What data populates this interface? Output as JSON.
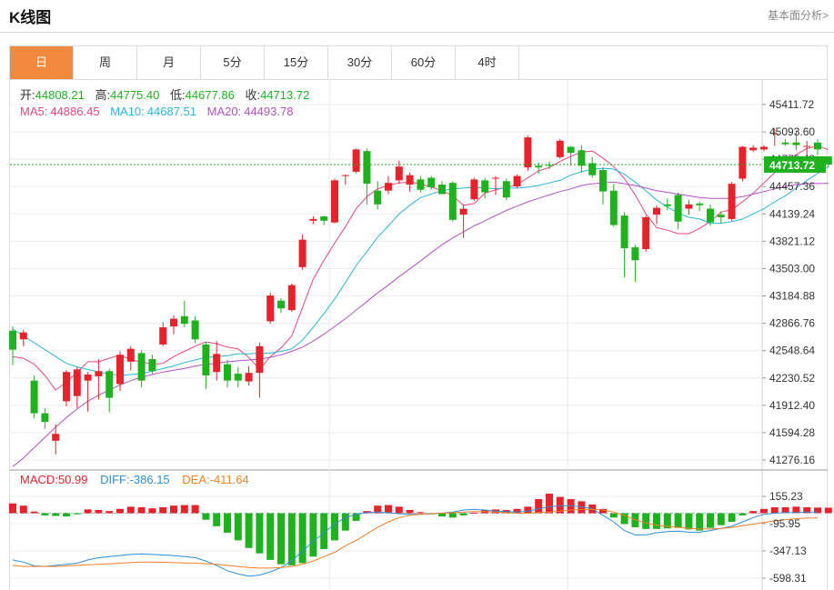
{
  "page": {
    "title": "K线图",
    "more_link": "基本面分析>"
  },
  "tabs": [
    {
      "label": "日",
      "active": true
    },
    {
      "label": "周",
      "active": false
    },
    {
      "label": "月",
      "active": false
    },
    {
      "label": "5分",
      "active": false
    },
    {
      "label": "15分",
      "active": false
    },
    {
      "label": "30分",
      "active": false
    },
    {
      "label": "60分",
      "active": false
    },
    {
      "label": "4时",
      "active": false
    }
  ],
  "ohlc_info": [
    {
      "label": "开:",
      "value": "44808.21"
    },
    {
      "label": "高:",
      "value": "44775.40"
    },
    {
      "label": "低:",
      "value": "44677.86"
    },
    {
      "label": "收:",
      "value": "44713.72"
    }
  ],
  "ma_info": [
    {
      "label": "MA5:",
      "value": "44886.45",
      "color": "#e8467c"
    },
    {
      "label": "MA10:",
      "value": "44687.51",
      "color": "#2bb5d8"
    },
    {
      "label": "MA20:",
      "value": "44493.78",
      "color": "#b450c4"
    }
  ],
  "macd_info": [
    {
      "label": "MACD:",
      "value": "50.99",
      "color": "#e8222a"
    },
    {
      "label": "DIFF:",
      "value": "-386.15",
      "color": "#2d8fd5"
    },
    {
      "label": "DEA:",
      "value": "-411.64",
      "color": "#f07f25"
    }
  ],
  "colors": {
    "up": "#e8222a",
    "down": "#1fb21f",
    "info_value": "#1fb21f",
    "last_price_bg": "#1fb21f",
    "tab_active": "#f28a3d"
  },
  "chart_data": {
    "type": "candlestick",
    "last_price": "44713.72",
    "price_axis_labels": [
      "45411.72",
      "45093.60",
      "44775.48",
      "44457.36",
      "44139.24",
      "43821.12",
      "43503.00",
      "43184.88",
      "42866.76",
      "42548.64",
      "42230.52",
      "41912.40",
      "41594.28",
      "41276.16"
    ],
    "price_ylim": [
      41276.16,
      45411.72
    ],
    "macd_axis_labels": [
      "155.23",
      "-95.95",
      "-347.13",
      "-598.31"
    ],
    "macd_ylim": [
      -598.31,
      155.23
    ],
    "candles": [
      [
        42780,
        42560,
        42830,
        42380
      ],
      [
        42680,
        42760,
        42790,
        42600
      ],
      [
        42200,
        41820,
        42260,
        41760
      ],
      [
        41820,
        41720,
        41880,
        41640
      ],
      [
        41500,
        41580,
        41690,
        41340
      ],
      [
        41960,
        42300,
        42320,
        41900
      ],
      [
        42020,
        42330,
        42360,
        41880
      ],
      [
        42200,
        42270,
        42300,
        41840
      ],
      [
        42250,
        42310,
        42450,
        41980
      ],
      [
        42310,
        42000,
        42340,
        41830
      ],
      [
        42160,
        42500,
        42540,
        42080
      ],
      [
        42420,
        42570,
        42600,
        42320
      ],
      [
        42520,
        42200,
        42550,
        42120
      ],
      [
        42450,
        42310,
        42500,
        42280
      ],
      [
        42620,
        42820,
        42880,
        42600
      ],
      [
        42830,
        42920,
        42960,
        42740
      ],
      [
        42950,
        42860,
        43130,
        42820
      ],
      [
        42900,
        42680,
        42950,
        42640
      ],
      [
        42620,
        42260,
        42650,
        42100
      ],
      [
        42300,
        42510,
        42660,
        42200
      ],
      [
        42390,
        42200,
        42440,
        42120
      ],
      [
        42280,
        42200,
        42360,
        42120
      ],
      [
        42190,
        42290,
        42370,
        42140
      ],
      [
        42290,
        42600,
        42640,
        42000
      ],
      [
        42890,
        43190,
        43220,
        42860
      ],
      [
        43130,
        43040,
        43160,
        42990
      ],
      [
        43020,
        43310,
        43330,
        43000
      ],
      [
        43520,
        43840,
        43900,
        43490
      ],
      [
        44060,
        44080,
        44110,
        44020
      ],
      [
        44110,
        44060,
        44120,
        44010
      ],
      [
        44040,
        44530,
        44550,
        44030
      ],
      [
        44580,
        44590,
        44600,
        44480
      ],
      [
        44630,
        44890,
        44900,
        44610
      ],
      [
        44870,
        44490,
        44900,
        44250
      ],
      [
        44410,
        44250,
        44520,
        44190
      ],
      [
        44410,
        44500,
        44580,
        44370
      ],
      [
        44530,
        44690,
        44760,
        44490
      ],
      [
        44480,
        44590,
        44620,
        44400
      ],
      [
        44540,
        44420,
        44580,
        44390
      ],
      [
        44560,
        44450,
        44580,
        44420
      ],
      [
        44480,
        44370,
        44520,
        44380
      ],
      [
        44500,
        44070,
        44520,
        44050
      ],
      [
        44130,
        44200,
        44250,
        43860
      ],
      [
        44310,
        44540,
        44560,
        44290
      ],
      [
        44530,
        44390,
        44560,
        44320
      ],
      [
        44560,
        44560,
        44580,
        44360
      ],
      [
        44520,
        44330,
        44550,
        44300
      ],
      [
        44460,
        44580,
        44600,
        44440
      ],
      [
        44680,
        45030,
        45050,
        44640
      ],
      [
        44700,
        44680,
        44740,
        44610
      ],
      [
        44710,
        44700,
        44750,
        44660
      ],
      [
        44800,
        44990,
        45010,
        44780
      ],
      [
        44920,
        44850,
        44930,
        44700
      ],
      [
        44880,
        44700,
        44940,
        44620
      ],
      [
        44730,
        44590,
        44800,
        44560
      ],
      [
        44650,
        44400,
        44680,
        44250
      ],
      [
        44410,
        44010,
        44490,
        43990
      ],
      [
        44120,
        43740,
        44160,
        43400
      ],
      [
        43750,
        43600,
        43780,
        43350
      ],
      [
        43730,
        44100,
        44120,
        43700
      ],
      [
        44130,
        44210,
        44240,
        44020
      ],
      [
        44250,
        44230,
        44320,
        44180
      ],
      [
        44360,
        44050,
        44390,
        43960
      ],
      [
        44200,
        44250,
        44300,
        44130
      ],
      [
        44260,
        44240,
        44280,
        44170
      ],
      [
        44200,
        44040,
        44250,
        44000
      ],
      [
        44130,
        44100,
        44170,
        44030
      ],
      [
        44080,
        44490,
        44510,
        44060
      ],
      [
        44550,
        44920,
        44930,
        44520
      ],
      [
        44880,
        44910,
        44940,
        44860
      ],
      [
        44890,
        44920,
        44940,
        44870
      ],
      [
        45070,
        45080,
        45130,
        44930
      ],
      [
        44970,
        44950,
        45010,
        44930
      ],
      [
        44970,
        44940,
        45110,
        44880
      ],
      [
        44920,
        44930,
        44990,
        44770
      ],
      [
        44970,
        44890,
        45010,
        44820
      ],
      [
        44808.21,
        44713.72,
        44775.4,
        44677.86
      ]
    ],
    "ma5": [
      42480,
      42460,
      42390,
      42260,
      42090,
      42180,
      42300,
      42420,
      42420,
      42460,
      42500,
      42440,
      42420,
      42390,
      42400,
      42480,
      42540,
      42600,
      42650,
      42630,
      42590,
      42570,
      42470,
      42330,
      42480,
      42580,
      42720,
      43050,
      43380,
      43600,
      43800,
      43990,
      44200,
      44340,
      44430,
      44470,
      44500,
      44510,
      44490,
      44450,
      44410,
      44350,
      44240,
      44260,
      44380,
      44420,
      44450,
      44480,
      44560,
      44640,
      44680,
      44750,
      44810,
      44860,
      44870,
      44790,
      44690,
      44550,
      44360,
      44140,
      43980,
      43950,
      43910,
      43910,
      43970,
      44050,
      44160,
      44190,
      44280,
      44380,
      44500,
      44620,
      44730,
      44830,
      44900,
      44930,
      44886.45
    ],
    "ma10": [
      42800,
      42720,
      42640,
      42560,
      42480,
      42400,
      42360,
      42330,
      42300,
      42280,
      42260,
      42270,
      42280,
      42310,
      42340,
      42370,
      42410,
      42440,
      42470,
      42480,
      42490,
      42510,
      42510,
      42520,
      42520,
      42540,
      42570,
      42670,
      42820,
      42980,
      43150,
      43340,
      43540,
      43700,
      43870,
      44000,
      44140,
      44240,
      44330,
      44370,
      44410,
      44430,
      44440,
      44450,
      44440,
      44430,
      44440,
      44440,
      44450,
      44470,
      44500,
      44530,
      44590,
      44630,
      44660,
      44670,
      44660,
      44600,
      44510,
      44410,
      44300,
      44220,
      44150,
      44100,
      44080,
      44030,
      44030,
      44050,
      44080,
      44140,
      44200,
      44280,
      44350,
      44440,
      44530,
      44610,
      44687.51
    ],
    "ma20": [
      41200,
      41300,
      41420,
      41540,
      41660,
      41770,
      41870,
      41960,
      42030,
      42090,
      42150,
      42200,
      42240,
      42270,
      42300,
      42320,
      42340,
      42370,
      42390,
      42400,
      42420,
      42430,
      42440,
      42450,
      42470,
      42500,
      42540,
      42590,
      42660,
      42740,
      42830,
      42920,
      43020,
      43120,
      43220,
      43310,
      43410,
      43500,
      43590,
      43690,
      43780,
      43860,
      43930,
      44000,
      44060,
      44120,
      44180,
      44230,
      44280,
      44320,
      44360,
      44400,
      44430,
      44470,
      44490,
      44500,
      44510,
      44490,
      44470,
      44440,
      44410,
      44390,
      44370,
      44350,
      44330,
      44320,
      44320,
      44320,
      44340,
      44370,
      44400,
      44430,
      44460,
      44480,
      44490,
      44495,
      44493.78
    ],
    "macd": [
      90,
      70,
      15,
      -20,
      -25,
      -30,
      -10,
      35,
      30,
      20,
      40,
      60,
      55,
      45,
      55,
      70,
      75,
      75,
      -60,
      -120,
      -180,
      -250,
      -320,
      -370,
      -430,
      -470,
      -480,
      -460,
      -400,
      -330,
      -250,
      -160,
      -70,
      20,
      70,
      75,
      60,
      30,
      10,
      -10,
      -30,
      -40,
      -20,
      5,
      30,
      35,
      30,
      40,
      60,
      130,
      180,
      150,
      130,
      110,
      80,
      40,
      -40,
      -100,
      -130,
      -145,
      -145,
      -140,
      -135,
      -150,
      -160,
      -135,
      -110,
      -80,
      -20,
      20,
      40,
      55,
      55,
      60,
      55,
      52,
      50.99
    ],
    "dif": [
      -430,
      -450,
      -485,
      -490,
      -480,
      -470,
      -460,
      -430,
      -410,
      -400,
      -390,
      -380,
      -375,
      -380,
      -385,
      -390,
      -400,
      -410,
      -440,
      -480,
      -530,
      -560,
      -580,
      -570,
      -540,
      -500,
      -440,
      -350,
      -260,
      -180,
      -100,
      -40,
      -10,
      5,
      10,
      5,
      -5,
      -10,
      -10,
      -5,
      0,
      10,
      30,
      35,
      30,
      20,
      15,
      10,
      20,
      40,
      60,
      70,
      70,
      60,
      40,
      -20,
      -80,
      -160,
      -200,
      -200,
      -180,
      -170,
      -165,
      -175,
      -175,
      -160,
      -140,
      -120,
      -80,
      -40,
      -10,
      0,
      5,
      5,
      10,
      10,
      -386.15
    ],
    "dea": [
      -480,
      -490,
      -490,
      -490,
      -490,
      -485,
      -480,
      -475,
      -470,
      -465,
      -460,
      -455,
      -450,
      -450,
      -452,
      -455,
      -458,
      -460,
      -465,
      -470,
      -480,
      -490,
      -500,
      -505,
      -505,
      -500,
      -490,
      -470,
      -440,
      -400,
      -360,
      -300,
      -250,
      -190,
      -130,
      -80,
      -40,
      -20,
      -10,
      -5,
      0,
      5,
      10,
      15,
      15,
      10,
      5,
      0,
      0,
      5,
      10,
      20,
      30,
      35,
      35,
      30,
      10,
      -20,
      -60,
      -90,
      -110,
      -120,
      -130,
      -140,
      -145,
      -145,
      -140,
      -130,
      -115,
      -100,
      -85,
      -70,
      -60,
      -50,
      -45,
      -42,
      -411.64
    ]
  }
}
